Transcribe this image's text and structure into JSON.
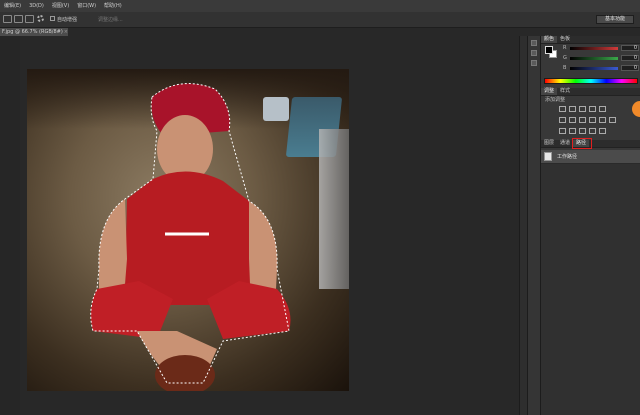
{
  "menubar": {
    "items": [
      "编辑(E)",
      "3D(D)",
      "视图(V)",
      "窗口(W)",
      "帮助(H)"
    ]
  },
  "options_bar": {
    "auto_enhance_label": "自动增强",
    "refine_edge_label": "调整边缘..."
  },
  "workspace_button": "基本功能",
  "document_tab": {
    "title": "F.jpg @ 66.7% (RGB/8#)"
  },
  "color_panel": {
    "title": "颜色",
    "tab2": "色板",
    "rows": [
      {
        "letter": "R",
        "value": "0",
        "color": "#d23a3a"
      },
      {
        "letter": "G",
        "value": "0",
        "color": "#3aa84a"
      },
      {
        "letter": "B",
        "value": "0",
        "color": "#3a5ad2"
      }
    ]
  },
  "adjustments_panel": {
    "title": "调整",
    "tab2": "样式",
    "subtitle": "添加调整"
  },
  "layers_panel": {
    "tabs": [
      "图层",
      "通道",
      "路径"
    ],
    "highlighted_tab_index": 2,
    "work_path_name": "工作路径"
  },
  "accent_colors": {
    "selection_highlight": "#e02020",
    "badge": "#f08a2a"
  }
}
